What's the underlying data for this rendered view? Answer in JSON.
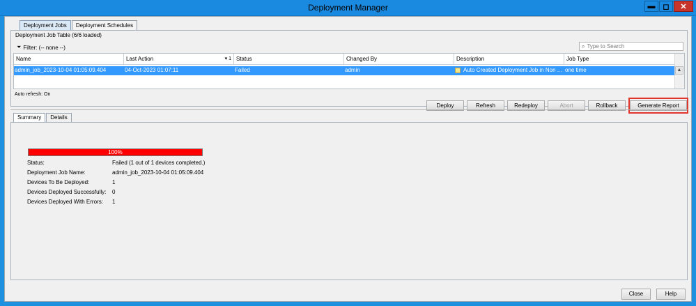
{
  "window": {
    "title": "Deployment Manager",
    "minimize": "▬",
    "maximize": "◻",
    "close": "✕"
  },
  "tabs": [
    "Deployment Jobs",
    "Deployment Schedules"
  ],
  "panel": {
    "caption": "Deployment Job Table (6/6 loaded)",
    "filter_label": "Filter: (-- none --)",
    "search_placeholder": "Type to Search"
  },
  "table": {
    "columns": [
      "Name",
      "Last Action",
      "Status",
      "Changed By",
      "Description",
      "Job Type"
    ],
    "sort_indicator": "▾ 1",
    "rows": [
      {
        "name": "admin_job_2023-10-04 01:05:09.404",
        "last_action": "04-Oct-2023 01:07:11",
        "status": "Failed",
        "changed_by": "admin",
        "description": "Auto Created Deployment Job in Non ...",
        "job_type": "one time"
      }
    ]
  },
  "auto_refresh": "Auto refresh: On",
  "actions": [
    "Deploy",
    "Refresh",
    "Redeploy",
    "Abort",
    "Rollback",
    "Generate Report"
  ],
  "detail_tabs": [
    "Summary",
    "Details"
  ],
  "summary": {
    "progress_percent": 100,
    "progress_label": "100%",
    "progress_color": "#ff0000",
    "fields": [
      {
        "label": "Status:",
        "value": "Failed  (1 out of 1 devices completed.)"
      },
      {
        "label": "Deployment Job Name:",
        "value": "admin_job_2023-10-04 01:05:09.404"
      },
      {
        "label": "Devices To Be Deployed:",
        "value": "1"
      },
      {
        "label": "Devices Deployed Successfully:",
        "value": "0"
      },
      {
        "label": "Devices Deployed With Errors:",
        "value": "1"
      }
    ]
  },
  "footer": {
    "close": "Close",
    "help": "Help"
  }
}
